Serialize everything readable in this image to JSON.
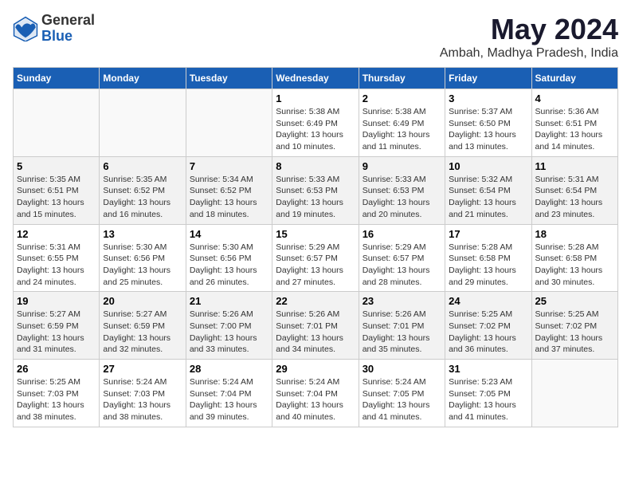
{
  "header": {
    "logo": {
      "general": "General",
      "blue": "Blue"
    },
    "title": "May 2024",
    "location": "Ambah, Madhya Pradesh, India"
  },
  "weekdays": [
    "Sunday",
    "Monday",
    "Tuesday",
    "Wednesday",
    "Thursday",
    "Friday",
    "Saturday"
  ],
  "weeks": [
    [
      {
        "day": "",
        "sunrise": "",
        "sunset": "",
        "daylight": ""
      },
      {
        "day": "",
        "sunrise": "",
        "sunset": "",
        "daylight": ""
      },
      {
        "day": "",
        "sunrise": "",
        "sunset": "",
        "daylight": ""
      },
      {
        "day": "1",
        "sunrise": "Sunrise: 5:38 AM",
        "sunset": "Sunset: 6:49 PM",
        "daylight": "Daylight: 13 hours and 10 minutes."
      },
      {
        "day": "2",
        "sunrise": "Sunrise: 5:38 AM",
        "sunset": "Sunset: 6:49 PM",
        "daylight": "Daylight: 13 hours and 11 minutes."
      },
      {
        "day": "3",
        "sunrise": "Sunrise: 5:37 AM",
        "sunset": "Sunset: 6:50 PM",
        "daylight": "Daylight: 13 hours and 13 minutes."
      },
      {
        "day": "4",
        "sunrise": "Sunrise: 5:36 AM",
        "sunset": "Sunset: 6:51 PM",
        "daylight": "Daylight: 13 hours and 14 minutes."
      }
    ],
    [
      {
        "day": "5",
        "sunrise": "Sunrise: 5:35 AM",
        "sunset": "Sunset: 6:51 PM",
        "daylight": "Daylight: 13 hours and 15 minutes."
      },
      {
        "day": "6",
        "sunrise": "Sunrise: 5:35 AM",
        "sunset": "Sunset: 6:52 PM",
        "daylight": "Daylight: 13 hours and 16 minutes."
      },
      {
        "day": "7",
        "sunrise": "Sunrise: 5:34 AM",
        "sunset": "Sunset: 6:52 PM",
        "daylight": "Daylight: 13 hours and 18 minutes."
      },
      {
        "day": "8",
        "sunrise": "Sunrise: 5:33 AM",
        "sunset": "Sunset: 6:53 PM",
        "daylight": "Daylight: 13 hours and 19 minutes."
      },
      {
        "day": "9",
        "sunrise": "Sunrise: 5:33 AM",
        "sunset": "Sunset: 6:53 PM",
        "daylight": "Daylight: 13 hours and 20 minutes."
      },
      {
        "day": "10",
        "sunrise": "Sunrise: 5:32 AM",
        "sunset": "Sunset: 6:54 PM",
        "daylight": "Daylight: 13 hours and 21 minutes."
      },
      {
        "day": "11",
        "sunrise": "Sunrise: 5:31 AM",
        "sunset": "Sunset: 6:54 PM",
        "daylight": "Daylight: 13 hours and 23 minutes."
      }
    ],
    [
      {
        "day": "12",
        "sunrise": "Sunrise: 5:31 AM",
        "sunset": "Sunset: 6:55 PM",
        "daylight": "Daylight: 13 hours and 24 minutes."
      },
      {
        "day": "13",
        "sunrise": "Sunrise: 5:30 AM",
        "sunset": "Sunset: 6:56 PM",
        "daylight": "Daylight: 13 hours and 25 minutes."
      },
      {
        "day": "14",
        "sunrise": "Sunrise: 5:30 AM",
        "sunset": "Sunset: 6:56 PM",
        "daylight": "Daylight: 13 hours and 26 minutes."
      },
      {
        "day": "15",
        "sunrise": "Sunrise: 5:29 AM",
        "sunset": "Sunset: 6:57 PM",
        "daylight": "Daylight: 13 hours and 27 minutes."
      },
      {
        "day": "16",
        "sunrise": "Sunrise: 5:29 AM",
        "sunset": "Sunset: 6:57 PM",
        "daylight": "Daylight: 13 hours and 28 minutes."
      },
      {
        "day": "17",
        "sunrise": "Sunrise: 5:28 AM",
        "sunset": "Sunset: 6:58 PM",
        "daylight": "Daylight: 13 hours and 29 minutes."
      },
      {
        "day": "18",
        "sunrise": "Sunrise: 5:28 AM",
        "sunset": "Sunset: 6:58 PM",
        "daylight": "Daylight: 13 hours and 30 minutes."
      }
    ],
    [
      {
        "day": "19",
        "sunrise": "Sunrise: 5:27 AM",
        "sunset": "Sunset: 6:59 PM",
        "daylight": "Daylight: 13 hours and 31 minutes."
      },
      {
        "day": "20",
        "sunrise": "Sunrise: 5:27 AM",
        "sunset": "Sunset: 6:59 PM",
        "daylight": "Daylight: 13 hours and 32 minutes."
      },
      {
        "day": "21",
        "sunrise": "Sunrise: 5:26 AM",
        "sunset": "Sunset: 7:00 PM",
        "daylight": "Daylight: 13 hours and 33 minutes."
      },
      {
        "day": "22",
        "sunrise": "Sunrise: 5:26 AM",
        "sunset": "Sunset: 7:01 PM",
        "daylight": "Daylight: 13 hours and 34 minutes."
      },
      {
        "day": "23",
        "sunrise": "Sunrise: 5:26 AM",
        "sunset": "Sunset: 7:01 PM",
        "daylight": "Daylight: 13 hours and 35 minutes."
      },
      {
        "day": "24",
        "sunrise": "Sunrise: 5:25 AM",
        "sunset": "Sunset: 7:02 PM",
        "daylight": "Daylight: 13 hours and 36 minutes."
      },
      {
        "day": "25",
        "sunrise": "Sunrise: 5:25 AM",
        "sunset": "Sunset: 7:02 PM",
        "daylight": "Daylight: 13 hours and 37 minutes."
      }
    ],
    [
      {
        "day": "26",
        "sunrise": "Sunrise: 5:25 AM",
        "sunset": "Sunset: 7:03 PM",
        "daylight": "Daylight: 13 hours and 38 minutes."
      },
      {
        "day": "27",
        "sunrise": "Sunrise: 5:24 AM",
        "sunset": "Sunset: 7:03 PM",
        "daylight": "Daylight: 13 hours and 38 minutes."
      },
      {
        "day": "28",
        "sunrise": "Sunrise: 5:24 AM",
        "sunset": "Sunset: 7:04 PM",
        "daylight": "Daylight: 13 hours and 39 minutes."
      },
      {
        "day": "29",
        "sunrise": "Sunrise: 5:24 AM",
        "sunset": "Sunset: 7:04 PM",
        "daylight": "Daylight: 13 hours and 40 minutes."
      },
      {
        "day": "30",
        "sunrise": "Sunrise: 5:24 AM",
        "sunset": "Sunset: 7:05 PM",
        "daylight": "Daylight: 13 hours and 41 minutes."
      },
      {
        "day": "31",
        "sunrise": "Sunrise: 5:23 AM",
        "sunset": "Sunset: 7:05 PM",
        "daylight": "Daylight: 13 hours and 41 minutes."
      },
      {
        "day": "",
        "sunrise": "",
        "sunset": "",
        "daylight": ""
      }
    ]
  ]
}
